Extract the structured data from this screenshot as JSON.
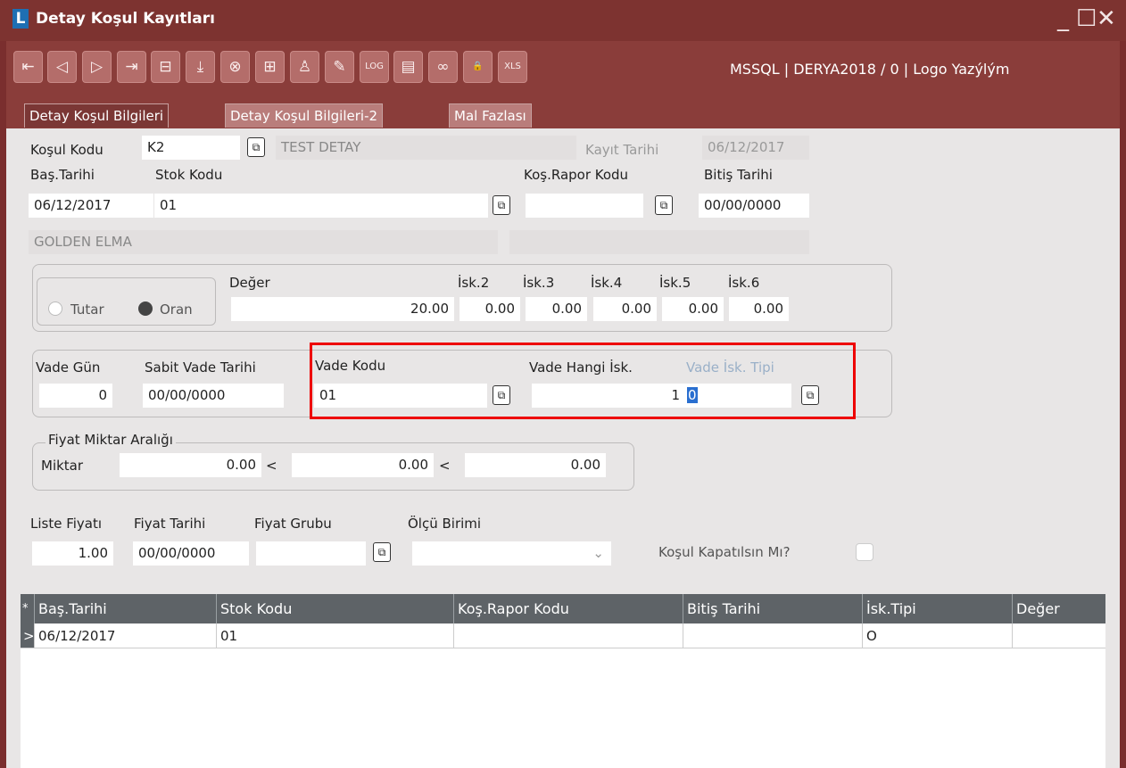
{
  "window": {
    "title": "Detay Koşul Kayıtları",
    "logo_letter": "L",
    "minimize": "_",
    "maximize": "☐",
    "close": "✕"
  },
  "toolbar": {
    "buttons": [
      {
        "icon": "first-record-icon",
        "glyph": "⇤"
      },
      {
        "icon": "previous-record-icon",
        "glyph": "◁"
      },
      {
        "icon": "next-record-icon",
        "glyph": "▷"
      },
      {
        "icon": "last-record-icon",
        "glyph": "⇥"
      },
      {
        "icon": "delete-record-icon",
        "glyph": "⊟"
      },
      {
        "icon": "save-icon",
        "glyph": "⤓"
      },
      {
        "icon": "cancel-icon",
        "glyph": "⊗"
      },
      {
        "icon": "new-record-icon",
        "glyph": "⊞"
      },
      {
        "icon": "user-icon",
        "glyph": "♙"
      },
      {
        "icon": "edit-icon",
        "glyph": "✎"
      },
      {
        "icon": "log-icon",
        "glyph": "LOG"
      },
      {
        "icon": "document-icon",
        "glyph": "▤"
      },
      {
        "icon": "link-icon",
        "glyph": "∞"
      },
      {
        "icon": "lock-icon",
        "glyph": "🔒"
      },
      {
        "icon": "excel-export-icon",
        "glyph": "XLS"
      }
    ],
    "db_info": "MSSQL | DERYA2018 / 0 | Logo Yazýlým"
  },
  "tabs": [
    "Detay Koşul Bilgileri",
    "Detay Koşul Bilgileri-2",
    "Mal Fazlası"
  ],
  "form": {
    "kosul_kodu_label": "Koşul Kodu",
    "kosul_kodu": "K2",
    "kosul_desc": "TEST DETAY",
    "kayit_tarihi_label": "Kayıt Tarihi",
    "kayit_tarihi": "06/12/2017",
    "bas_tarihi_label": "Baş.Tarihi",
    "bas_tarihi": "06/12/2017",
    "stok_kodu_label": "Stok Kodu",
    "stok_kodu": "01",
    "kos_rapor_label": "Koş.Rapor Kodu",
    "kos_rapor": "",
    "bitis_tarihi_label": "Bitiş Tarihi",
    "bitis_tarihi": "00/00/0000",
    "stok_adi": "GOLDEN ELMA",
    "stok_extra": "",
    "lookup_glyph": "⧉"
  },
  "discount": {
    "tutar_label": "Tutar",
    "oran_label": "Oran",
    "selected": "Oran",
    "deger_label": "Değer",
    "deger": "20.00",
    "isk_labels": [
      "İsk.2",
      "İsk.3",
      "İsk.4",
      "İsk.5",
      "İsk.6"
    ],
    "isk_values": [
      "0.00",
      "0.00",
      "0.00",
      "0.00",
      "0.00"
    ]
  },
  "vade": {
    "vade_gun_label": "Vade Gün",
    "vade_gun": "0",
    "sabit_vade_label": "Sabit Vade Tarihi",
    "sabit_vade": "00/00/0000",
    "vade_kodu_label": "Vade Kodu",
    "vade_kodu": "01",
    "vade_hangi_label": "Vade Hangi İsk.",
    "vade_hangi": "1",
    "vade_tipi_label": "Vade İsk. Tipi",
    "vade_tipi": "0"
  },
  "price_range": {
    "group_label": "Fiyat Miktar Aralığı",
    "miktar_label": "Miktar",
    "values": [
      "0.00",
      "0.00",
      "0.00"
    ],
    "separator": "<"
  },
  "price": {
    "liste_label": "Liste Fiyatı",
    "liste": "1.00",
    "fiyat_tarihi_label": "Fiyat Tarihi",
    "fiyat_tarihi": "00/00/0000",
    "fiyat_grubu_label": "Fiyat Grubu",
    "fiyat_grubu": "",
    "olcu_label": "Ölçü Birimi",
    "olcu": "",
    "kapat_label": "Koşul Kapatılsın Mı?"
  },
  "grid": {
    "headers": [
      "Baş.Tarihi",
      "Stok Kodu",
      "Koş.Rapor Kodu",
      "Bitiş Tarihi",
      "İsk.Tipi",
      "Değer"
    ],
    "rows": [
      [
        "06/12/2017",
        "01",
        "",
        "",
        "O",
        ""
      ]
    ],
    "row_marker": ">",
    "new_row_marker": "*"
  }
}
